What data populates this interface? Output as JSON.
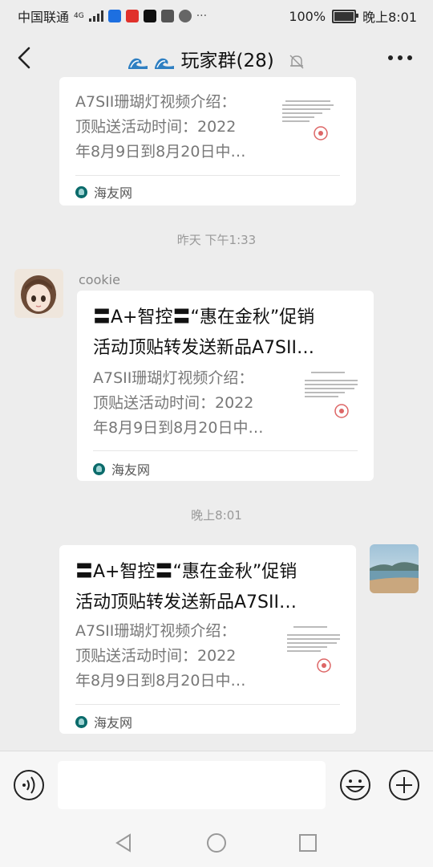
{
  "status": {
    "carrier": "中国联通",
    "net": "4G",
    "battery": "100%",
    "time": "晚上8:01"
  },
  "header": {
    "title": "玩家群(28)"
  },
  "messages": [
    {
      "desc": "A7SII珊瑚灯视频介绍：\n顶贴送活动时间：2022\n年8月9日到8月20日中…",
      "source": "海友网"
    },
    {
      "time": "昨天 下午1:33",
      "sender": "cookie",
      "title": "〓A+智控〓“惠在金秋”促销\n活动顶贴转发送新品A7SII…",
      "desc": "A7SII珊瑚灯视频介绍：\n顶贴送活动时间：2022\n年8月9日到8月20日中…",
      "source": "海友网"
    },
    {
      "time": "晚上8:01",
      "title": "〓A+智控〓“惠在金秋”促销\n活动顶贴转发送新品A7SII…",
      "desc": "A7SII珊瑚灯视频介绍：\n顶贴送活动时间：2022\n年8月9日到8月20日中…",
      "source": "海友网"
    }
  ],
  "icons": {
    "back": "chevron-left-icon",
    "mute": "bell-mute-icon",
    "more": "more-icon",
    "voice": "voice-icon",
    "emoji": "emoji-icon",
    "plus": "plus-icon"
  },
  "colors": {
    "bg": "#ededed",
    "bubble": "#ffffff",
    "link_logo": "#0b6b6b"
  }
}
